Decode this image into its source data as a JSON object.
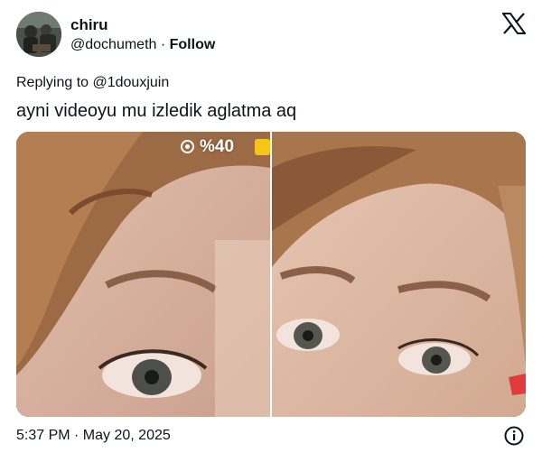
{
  "author": {
    "display_name": "chiru",
    "handle": "@dochumeth",
    "separator": " · ",
    "follow_label": "Follow"
  },
  "tweet": {
    "reply_text": "Replying to @1douxjuin",
    "text": "ayni videoyu mu izledik aglatma aq",
    "timestamp": "5:37 PM · May 20, 2025"
  },
  "media": {
    "overlay_status": "%40",
    "battery_color": "#f5c518"
  },
  "icons": {
    "logo": "x-logo-icon",
    "info": "info-icon",
    "overlay": "record-indicator-icon"
  },
  "colors": {
    "text": "#0f1419",
    "background": "#ffffff"
  }
}
